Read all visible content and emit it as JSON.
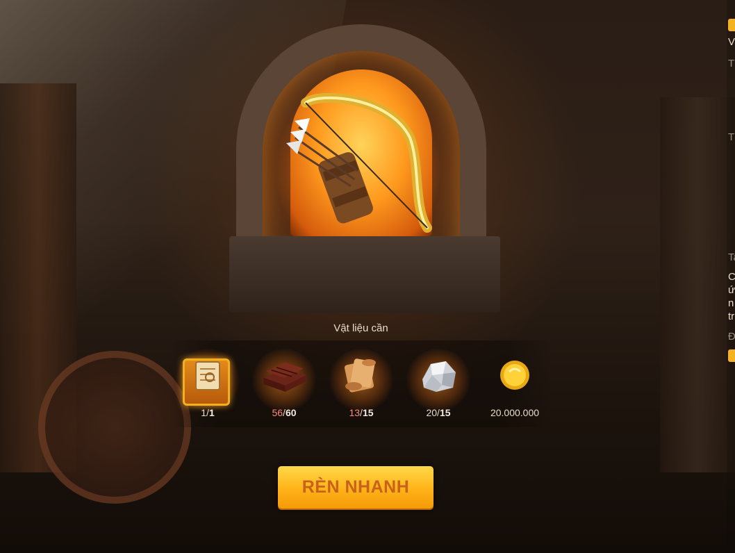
{
  "materials": {
    "title": "Vật liệu cần",
    "items": [
      {
        "icon": "blueprint-scroll-icon",
        "have": "1",
        "sep": "/",
        "need": "1",
        "sufficient": true
      },
      {
        "icon": "leather-stack-icon",
        "have": "56",
        "sep": "/",
        "need": "60",
        "sufficient": false
      },
      {
        "icon": "parchment-bundle-icon",
        "have": "13",
        "sep": "/",
        "need": "15",
        "sufficient": false
      },
      {
        "icon": "silver-ore-icon",
        "have": "20",
        "sep": "/",
        "need": "15",
        "sufficient": true
      },
      {
        "icon": "gold-coin-icon",
        "amount": "20.000.000"
      }
    ]
  },
  "action": {
    "forge_label": "RÈN NHANH"
  },
  "side_panel": {
    "fragments": [
      "V",
      "T",
      "T",
      "Ta",
      "C",
      "ứ",
      "n",
      "tr",
      "Đ"
    ]
  },
  "colors": {
    "accent_button": "#ffb318",
    "button_text": "#c8621a",
    "short_count": "#ff8a7a"
  }
}
